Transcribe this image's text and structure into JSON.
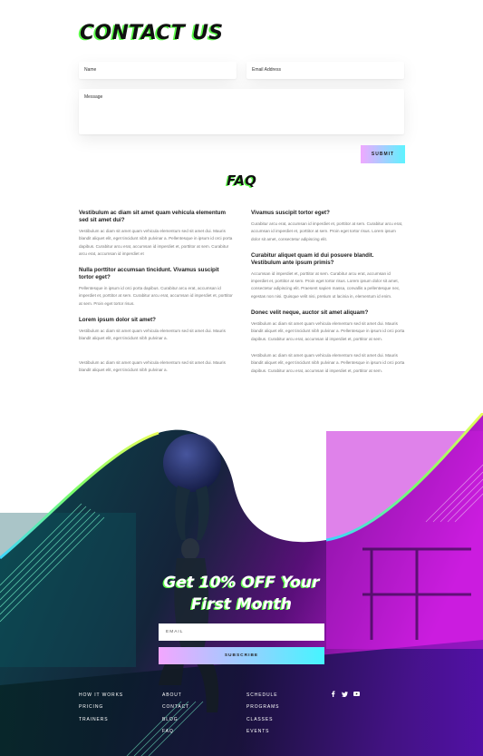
{
  "contact": {
    "title": "CONTACT US",
    "name_placeholder": "Name",
    "email_placeholder": "Email Address",
    "message_placeholder": "Message",
    "submit_label": "SUBMIT"
  },
  "faq": {
    "title": "FAQ",
    "left": [
      {
        "q": "Vestibulum ac diam sit amet quam vehicula elementum sed sit amet dui?",
        "a": "Vestibulum ac diam sit amet quam vehicula elementum sed sit amet dui. Mauris blandit aliquet elit, eget tincidunt nibh pulvinar a. Pellentesque in ipsum id orci porta dapibus. Curabitur arcu erat, accumsan id imperdiet et, porttitor at sem. Curabitur arcu erat, accumsan id imperdiet et"
      },
      {
        "q": "Nulla porttitor accumsan tincidunt. Vivamus suscipit tortor eget?",
        "a": "Pellentesque in ipsum id orci porta dapibus. Curabitur arcu erat, accumsan id imperdiet et, porttitor at sem. Curabitur arcu erat, accumsan id imperdiet et, porttitor at sem. Proin eget tortor risus."
      },
      {
        "q": "Lorem ipsum dolor sit amet?",
        "a": "Vestibulum ac diam sit amet quam vehicula elementum sed sit amet dui. Mauris blandit aliquet elit, eget tincidunt nibh pulvinar a."
      },
      {
        "q": "",
        "a": "Vestibulum ac diam sit amet quam vehicula elementum sed sit amet dui. Mauris blandit aliquet elit, eget tincidunt nibh pulvinar a."
      }
    ],
    "right": [
      {
        "q": "Vivamus suscipit tortor eget?",
        "a": "Curabitur arcu erat, accumsan id imperdiet et, porttitor at sem. Curabitur arcu erat, accumsan id imperdiet et, porttitor at sem. Proin eget tortor risus. Lorem ipsum dolor sit amet, consectetur adipiscing elit."
      },
      {
        "q": "Curabitur aliquet quam id dui posuere blandit. Vestibulum ante ipsum primis?",
        "a": "Accumsan id imperdiet et, porttitor at sem. Curabitur arcu erat, accumsan id imperdiet et, porttitor at sem. Proin eget tortor risus. Lorem ipsum dolor sit amet, consectetur adipiscing elit. Praesent sapien massa, convallis a pellentesque nec, egestas non nisi. Quisque velit nisi, pretium ut lacinia in, elementum id enim."
      },
      {
        "q": "Donec velit neque, auctor sit amet aliquam?",
        "a": "Vestibulum ac diam sit amet quam vehicula elementum sed sit amet dui. Mauris blandit aliquet elit, eget tincidunt nibh pulvinar a. Pellentesque in ipsum id orci porta dapibus. Curabitur arcu erat, accumsan id imperdiet et, porttitor at sem."
      },
      {
        "q": "",
        "a": "Vestibulum ac diam sit amet quam vehicula elementum sed sit amet dui. Mauris blandit aliquet elit, eget tincidunt nibh pulvinar a. Pellentesque in ipsum id orci porta dapibus. Curabitur arcu erat, accumsan id imperdiet et, porttitor at sem."
      }
    ]
  },
  "promo": {
    "line1": "Get 10% OFF Your",
    "line2": "First Month",
    "email_placeholder": "EMAIL",
    "subscribe_label": "SUBSCRIBE"
  },
  "footer": {
    "col1": [
      "HOW IT WORKS",
      "PRICING",
      "TRAINERS"
    ],
    "col2": [
      "ABOUT",
      "CONTACT",
      "BLOG",
      "FAQ"
    ],
    "col3": [
      "SCHEDULE",
      "PROGRAMS",
      "CLASSES",
      "EVENTS"
    ],
    "social": [
      {
        "icon": "facebook-icon",
        "glyph": "f"
      },
      {
        "icon": "twitter-icon",
        "glyph": "t"
      },
      {
        "icon": "youtube-icon",
        "glyph": "▶"
      }
    ]
  },
  "colors": {
    "accent_green": "#5dff4a",
    "gradient_pink": "#f0a8ff",
    "gradient_cyan": "#5df3ff",
    "hero_purple": "#c21bd6",
    "hero_teal": "#0e6b6b"
  }
}
